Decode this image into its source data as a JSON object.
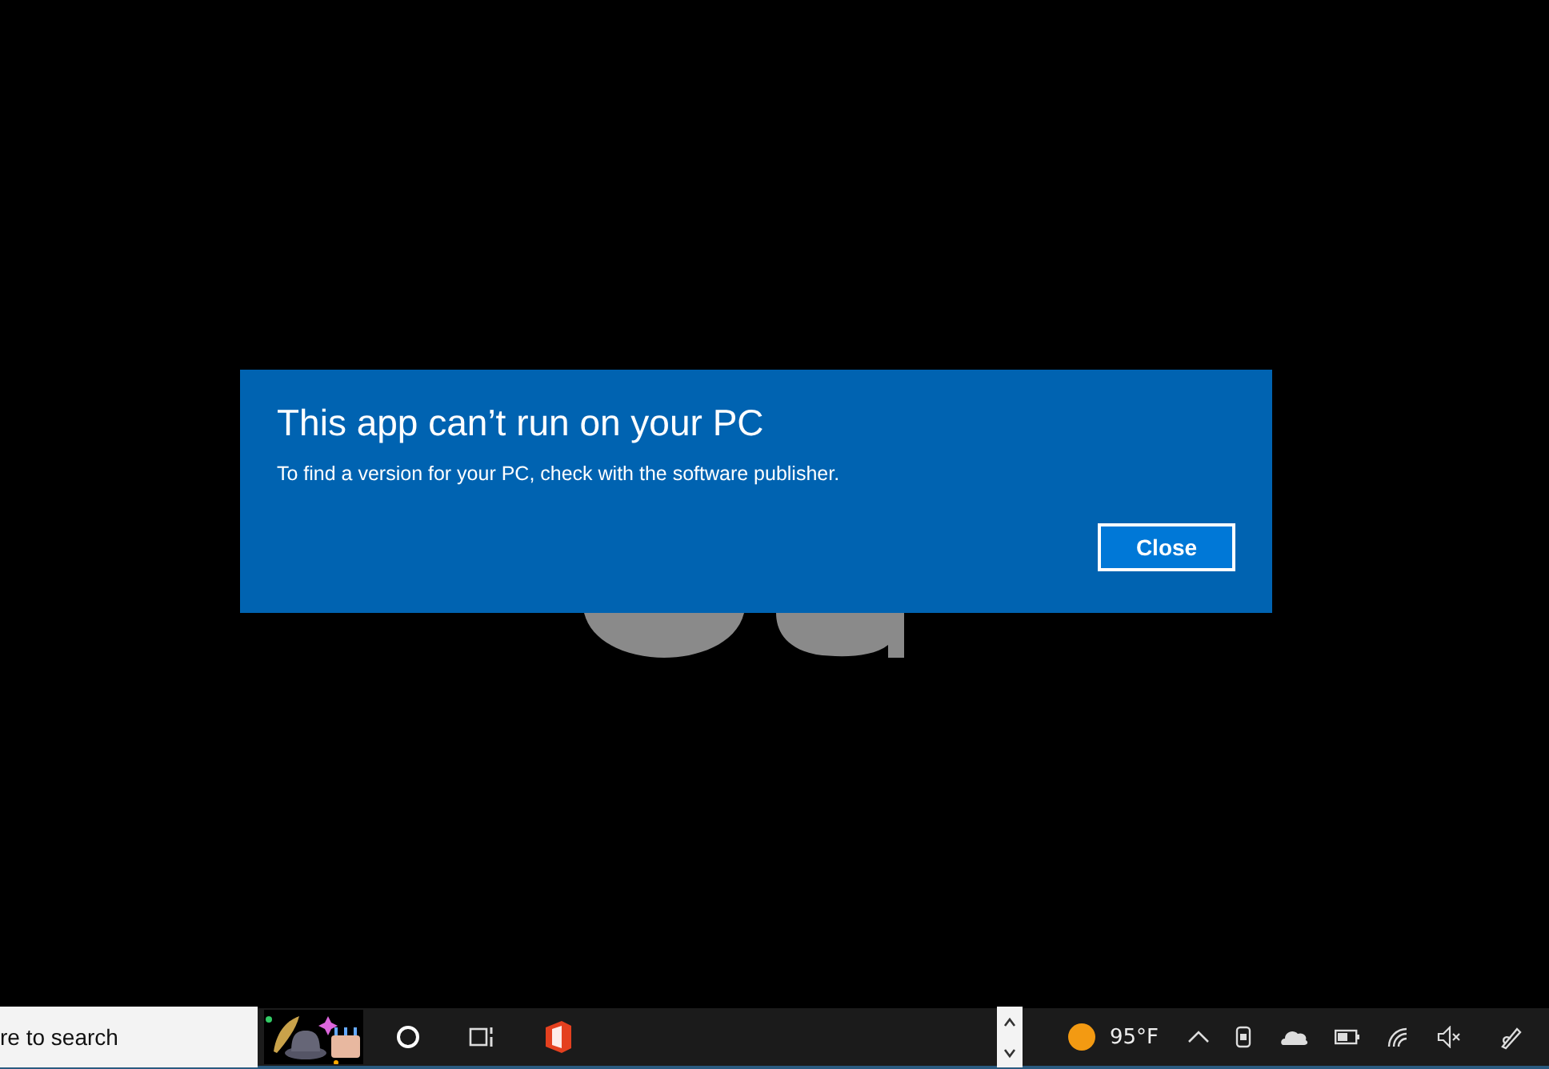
{
  "dialog": {
    "title": "This app can’t run on your PC",
    "message": "To find a version for your PC, check with the software publisher.",
    "button": "Close"
  },
  "taskbar": {
    "search": {
      "placeholder": "re to search"
    },
    "weather": {
      "temperature": "95°F"
    }
  }
}
